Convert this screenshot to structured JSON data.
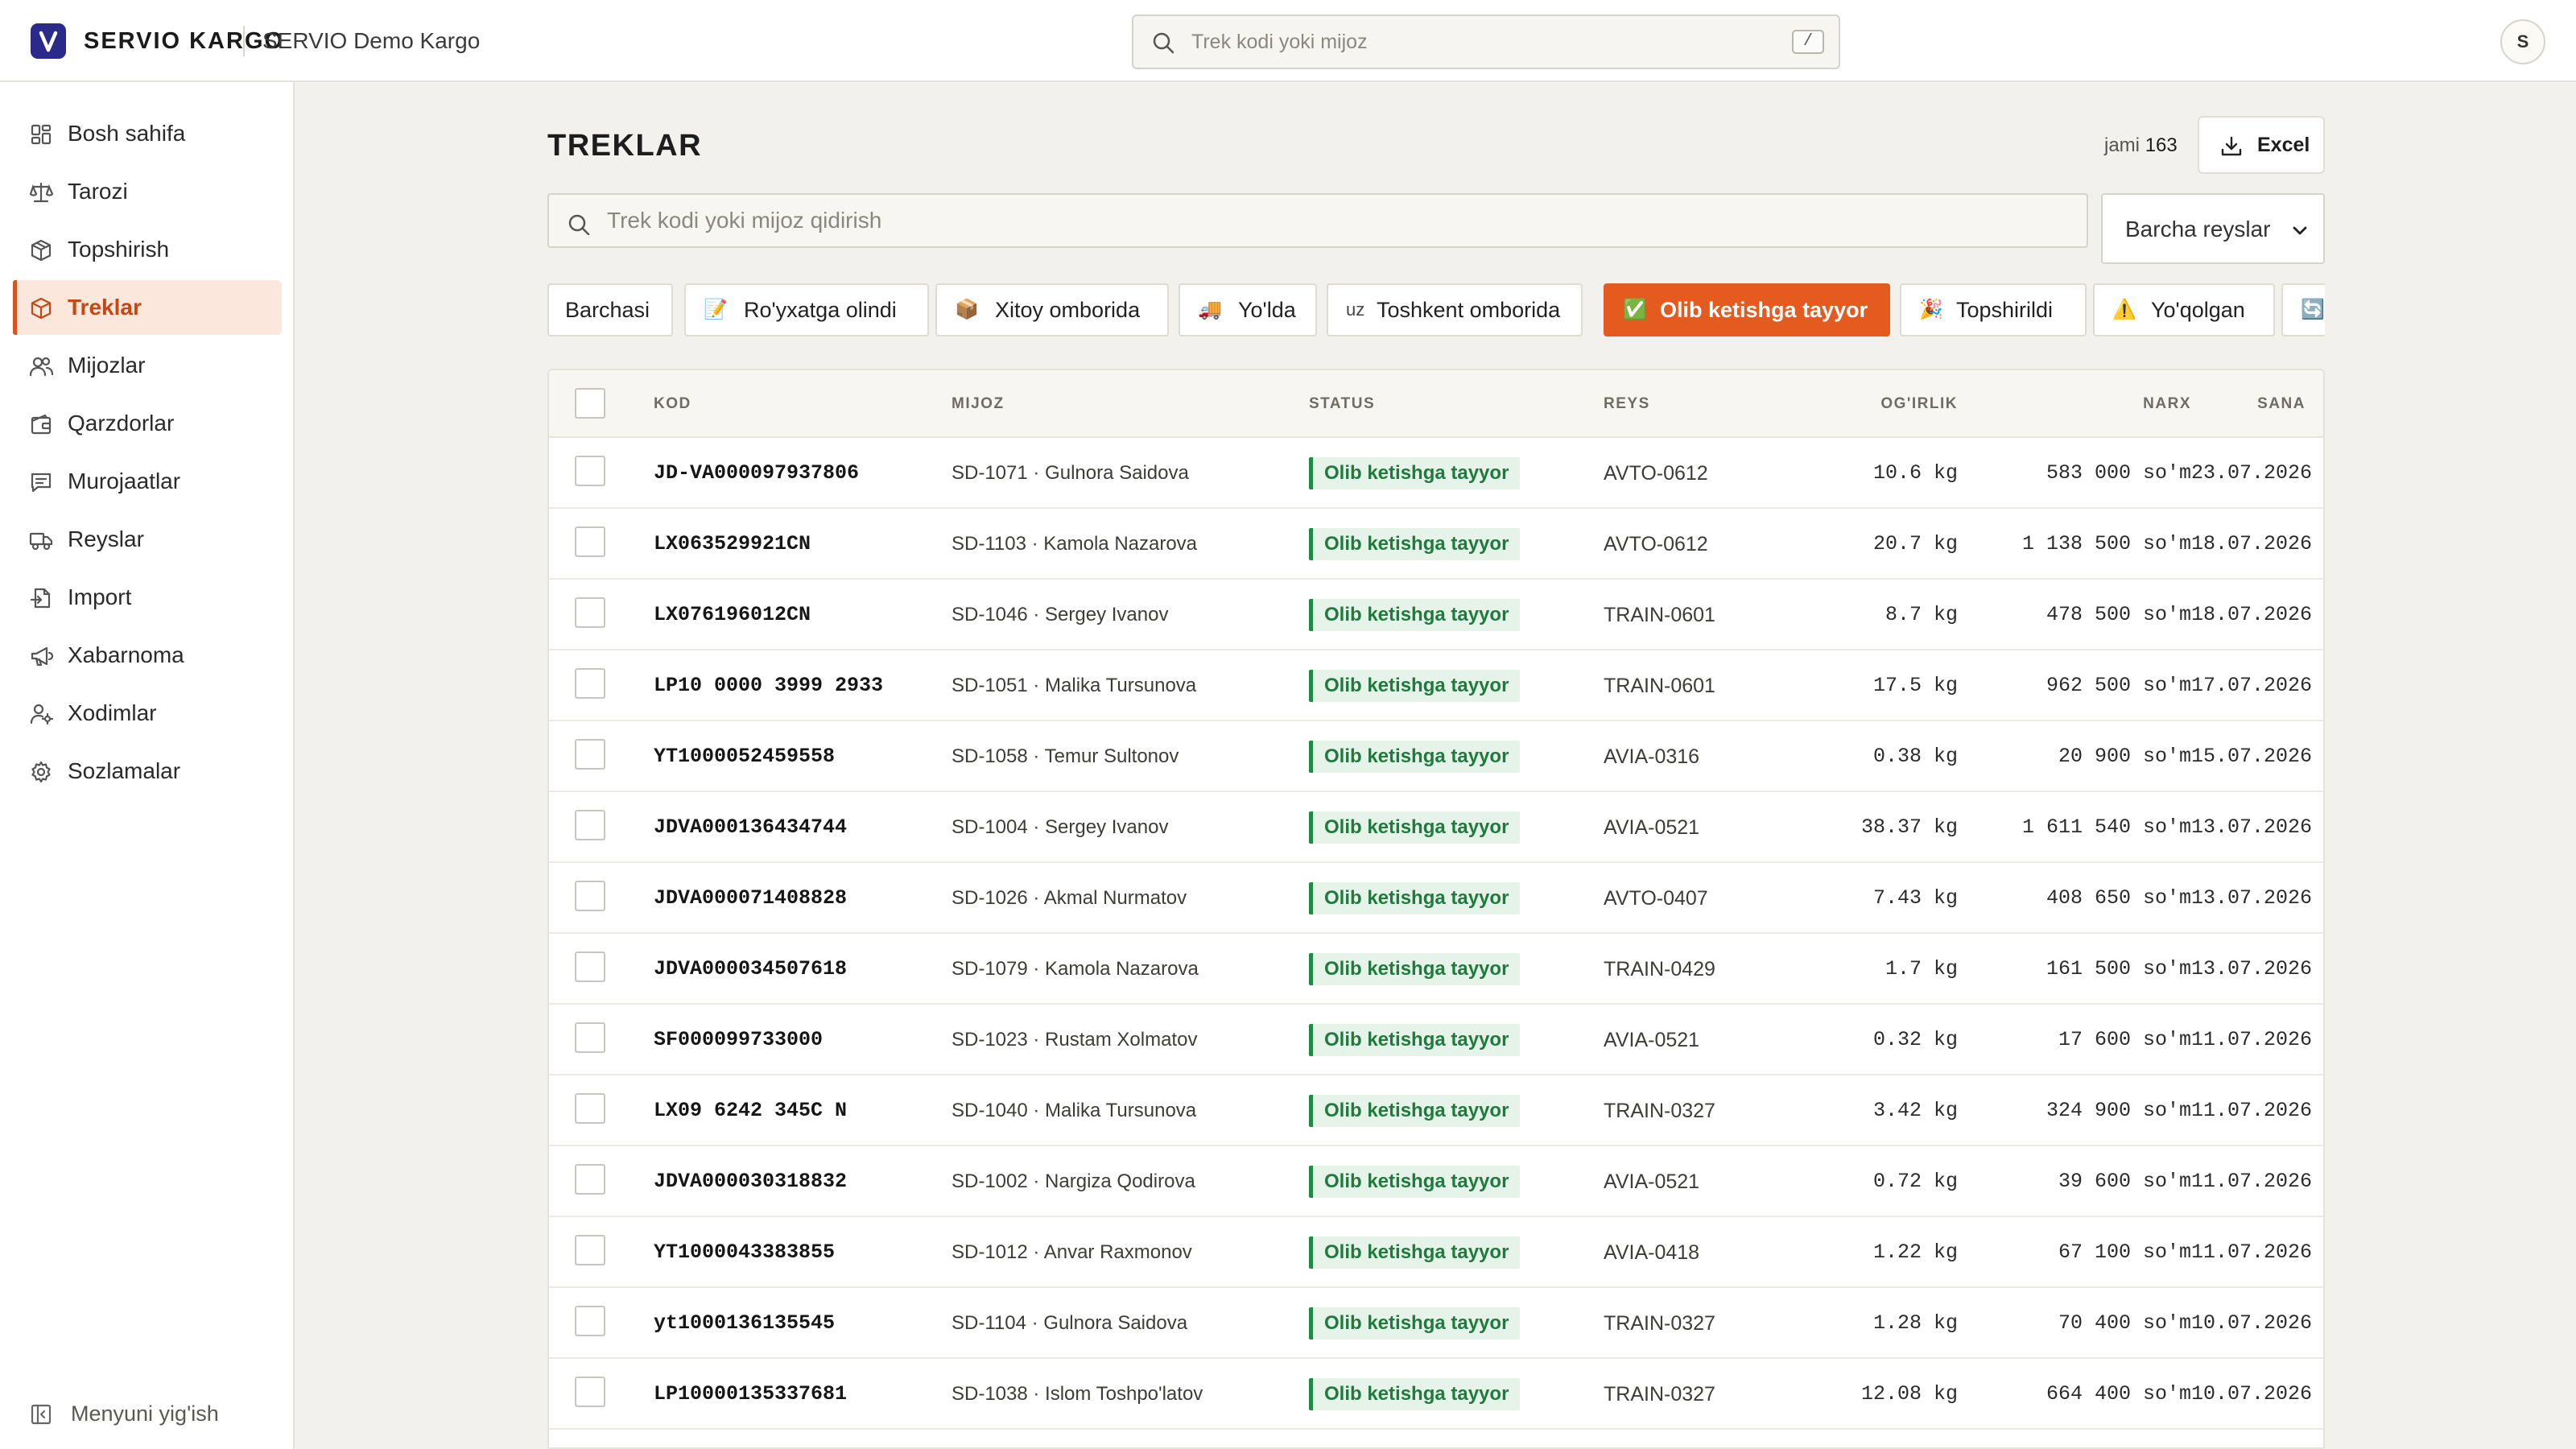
{
  "app": {
    "brand": "SERVIO KARGO",
    "company": "SERVIO Demo Kargo",
    "avatar_initial": "S"
  },
  "global_search": {
    "placeholder": "Trek kodi yoki mijoz",
    "shortcut": "/"
  },
  "colors": {
    "accent": "#e45a1f",
    "brand": "#2b2a8a",
    "status_green": "#1f7a3d"
  },
  "sidebar": {
    "items": [
      {
        "label": "Bosh sahifa",
        "icon": "dashboard-icon",
        "active": false
      },
      {
        "label": "Tarozi",
        "icon": "scale-icon",
        "active": false
      },
      {
        "label": "Topshirish",
        "icon": "package-icon",
        "active": false
      },
      {
        "label": "Treklar",
        "icon": "box-icon",
        "active": true
      },
      {
        "label": "Mijozlar",
        "icon": "users-icon",
        "active": false
      },
      {
        "label": "Qarzdorlar",
        "icon": "wallet-icon",
        "active": false
      },
      {
        "label": "Murojaatlar",
        "icon": "message-icon",
        "active": false
      },
      {
        "label": "Reyslar",
        "icon": "truck-icon",
        "active": false
      },
      {
        "label": "Import",
        "icon": "import-icon",
        "active": false
      },
      {
        "label": "Xabarnoma",
        "icon": "megaphone-icon",
        "active": false
      },
      {
        "label": "Xodimlar",
        "icon": "staff-icon",
        "active": false
      },
      {
        "label": "Sozlamalar",
        "icon": "gear-icon",
        "active": false
      }
    ],
    "collapse_label": "Menyuni yig'ish"
  },
  "page": {
    "title": "TREKLAR",
    "total_label": "jami",
    "total_count": "163",
    "excel_label": "Excel",
    "search_placeholder": "Trek kodi yoki mijoz qidirish",
    "reys_filter": "Barcha reyslar"
  },
  "filters": [
    {
      "label": "Barchasi",
      "emoji": "",
      "active": false
    },
    {
      "label": "Ro'yxatga olindi",
      "emoji": "📝",
      "active": false
    },
    {
      "label": "Xitoy omborida",
      "emoji": "📦",
      "active": false
    },
    {
      "label": "Yo'lda",
      "emoji": "🚚",
      "active": false
    },
    {
      "label": "Toshkent omborida",
      "emoji": "uz",
      "active": false
    },
    {
      "label": "Olib ketishga tayyor",
      "emoji": "✅",
      "active": true
    },
    {
      "label": "Topshirildi",
      "emoji": "🎉",
      "active": false
    },
    {
      "label": "Yo'qolgan",
      "emoji": "⚠️",
      "active": false
    },
    {
      "label": "",
      "emoji": "🔄",
      "active": false
    }
  ],
  "table": {
    "columns": [
      "KOD",
      "MIJOZ",
      "STATUS",
      "REYS",
      "OG'IRLIK",
      "NARX",
      "SANA"
    ],
    "rows": [
      {
        "code": "JD-VA000097937806",
        "client": "SD-1071 · Gulnora Saidova",
        "status": "Olib ketishga tayyor",
        "reys": "AVTO-0612",
        "weight": "10.6 kg",
        "price": "583 000 so'm",
        "date": "23.07.2026"
      },
      {
        "code": "LX063529921CN",
        "client": "SD-1103 · Kamola Nazarova",
        "status": "Olib ketishga tayyor",
        "reys": "AVTO-0612",
        "weight": "20.7 kg",
        "price": "1 138 500 so'm",
        "date": "18.07.2026"
      },
      {
        "code": "LX076196012CN",
        "client": "SD-1046 · Sergey Ivanov",
        "status": "Olib ketishga tayyor",
        "reys": "TRAIN-0601",
        "weight": "8.7 kg",
        "price": "478 500 so'm",
        "date": "18.07.2026"
      },
      {
        "code": "LP10 0000 3999 2933",
        "client": "SD-1051 · Malika Tursunova",
        "status": "Olib ketishga tayyor",
        "reys": "TRAIN-0601",
        "weight": "17.5 kg",
        "price": "962 500 so'm",
        "date": "17.07.2026"
      },
      {
        "code": "YT1000052459558",
        "client": "SD-1058 · Temur Sultonov",
        "status": "Olib ketishga tayyor",
        "reys": "AVIA-0316",
        "weight": "0.38 kg",
        "price": "20 900 so'm",
        "date": "15.07.2026"
      },
      {
        "code": "JDVA000136434744",
        "client": "SD-1004 · Sergey Ivanov",
        "status": "Olib ketishga tayyor",
        "reys": "AVIA-0521",
        "weight": "38.37 kg",
        "price": "1 611 540 so'm",
        "date": "13.07.2026"
      },
      {
        "code": "JDVA000071408828",
        "client": "SD-1026 · Akmal Nurmatov",
        "status": "Olib ketishga tayyor",
        "reys": "AVTO-0407",
        "weight": "7.43 kg",
        "price": "408 650 so'm",
        "date": "13.07.2026"
      },
      {
        "code": "JDVA000034507618",
        "client": "SD-1079 · Kamola Nazarova",
        "status": "Olib ketishga tayyor",
        "reys": "TRAIN-0429",
        "weight": "1.7 kg",
        "price": "161 500 so'm",
        "date": "13.07.2026"
      },
      {
        "code": "SF000099733000",
        "client": "SD-1023 · Rustam Xolmatov",
        "status": "Olib ketishga tayyor",
        "reys": "AVIA-0521",
        "weight": "0.32 kg",
        "price": "17 600 so'm",
        "date": "11.07.2026"
      },
      {
        "code": "LX09 6242 345C N",
        "client": "SD-1040 · Malika Tursunova",
        "status": "Olib ketishga tayyor",
        "reys": "TRAIN-0327",
        "weight": "3.42 kg",
        "price": "324 900 so'm",
        "date": "11.07.2026"
      },
      {
        "code": "JDVA000030318832",
        "client": "SD-1002 · Nargiza Qodirova",
        "status": "Olib ketishga tayyor",
        "reys": "AVIA-0521",
        "weight": "0.72 kg",
        "price": "39 600 so'm",
        "date": "11.07.2026"
      },
      {
        "code": "YT1000043383855",
        "client": "SD-1012 · Anvar Raxmonov",
        "status": "Olib ketishga tayyor",
        "reys": "AVIA-0418",
        "weight": "1.22 kg",
        "price": "67 100 so'm",
        "date": "11.07.2026"
      },
      {
        "code": "yt1000136135545",
        "client": "SD-1104 · Gulnora Saidova",
        "status": "Olib ketishga tayyor",
        "reys": "TRAIN-0327",
        "weight": "1.28 kg",
        "price": "70 400 so'm",
        "date": "10.07.2026"
      },
      {
        "code": "LP10000135337681",
        "client": "SD-1038 · Islom Toshpo'latov",
        "status": "Olib ketishga tayyor",
        "reys": "TRAIN-0327",
        "weight": "12.08 kg",
        "price": "664 400 so'm",
        "date": "10.07.2026"
      }
    ]
  }
}
